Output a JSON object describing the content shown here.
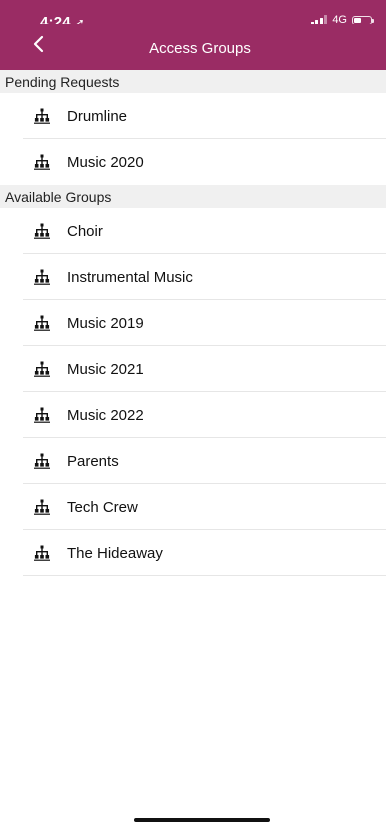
{
  "status_bar": {
    "time": "4:24",
    "network": "4G",
    "background_color": "#9a2c64"
  },
  "nav_bar": {
    "title": "Access Groups",
    "back_icon": "chevron-left-icon"
  },
  "sections": [
    {
      "header": "Pending Requests",
      "items": [
        {
          "label": "Drumline",
          "icon": "group-tree-icon"
        },
        {
          "label": "Music 2020",
          "icon": "group-tree-icon"
        }
      ]
    },
    {
      "header": "Available Groups",
      "items": [
        {
          "label": "Choir",
          "icon": "group-tree-icon"
        },
        {
          "label": "Instrumental Music",
          "icon": "group-tree-icon"
        },
        {
          "label": "Music 2019",
          "icon": "group-tree-icon"
        },
        {
          "label": "Music 2021",
          "icon": "group-tree-icon"
        },
        {
          "label": "Music 2022",
          "icon": "group-tree-icon"
        },
        {
          "label": "Parents",
          "icon": "group-tree-icon"
        },
        {
          "label": "Tech Crew",
          "icon": "group-tree-icon"
        },
        {
          "label": "The Hideaway",
          "icon": "group-tree-icon"
        }
      ]
    }
  ]
}
